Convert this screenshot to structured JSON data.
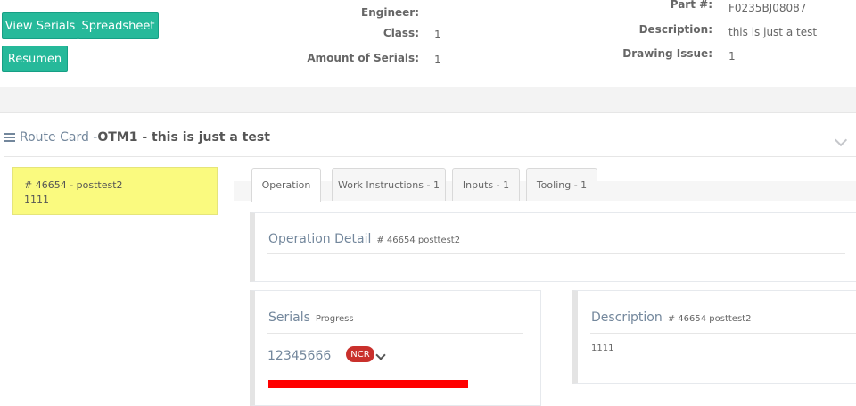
{
  "toolbar": {
    "view_serials_label": "View Serials",
    "spreadsheet_label": "Spreadsheet",
    "resumen_label": "Resumen"
  },
  "info_middle": {
    "engineer_label": "Engineer:",
    "engineer_value": "",
    "class_label": "Class:",
    "class_value": "1",
    "amount_label": "Amount of Serials:",
    "amount_value": "1"
  },
  "info_right": {
    "part_label": "Part #:",
    "part_value": "F0235BJ08087",
    "description_label": "Description:",
    "description_value": "this is just a test",
    "drawing_label": "Drawing Issue:",
    "drawing_value": "1"
  },
  "route_card": {
    "prefix": "Route Card -",
    "title": "OTM1 - this is just a test"
  },
  "operation_card": {
    "line1": "# 46654 - posttest2",
    "line2": "1111"
  },
  "tabs": [
    {
      "label": "Operation"
    },
    {
      "label": "Work Instructions - 1"
    },
    {
      "label": "Inputs - 1"
    },
    {
      "label": "Tooling - 1"
    }
  ],
  "operation_detail": {
    "title": "Operation Detail",
    "subtitle": "# 46654 posttest2"
  },
  "serials_panel": {
    "title": "Serials",
    "subtitle": "Progress",
    "serial_number": "12345666",
    "badge": "NCR",
    "progress_color": "#ff0000"
  },
  "description_panel": {
    "title": "Description",
    "subtitle": "# 46654 posttest2",
    "body": "1111"
  },
  "colors": {
    "primary_button": "#26b99a",
    "operation_highlight": "#fafa7f",
    "ncr_badge": "#c9302c"
  }
}
